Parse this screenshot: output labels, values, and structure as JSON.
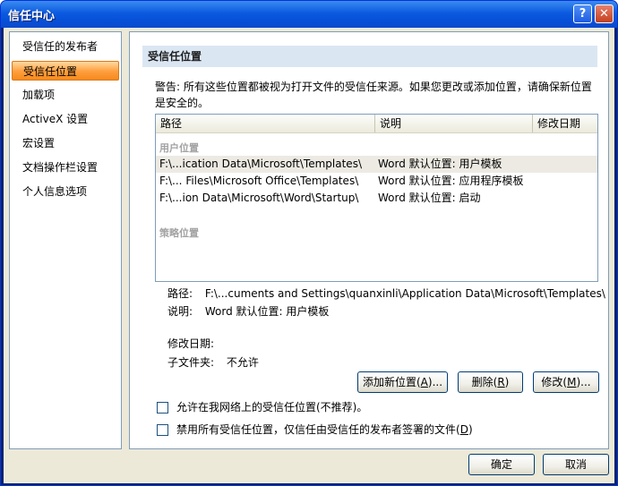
{
  "window": {
    "title": "信任中心",
    "help_label": "?",
    "close_label": "✕"
  },
  "sidebar": {
    "items": [
      {
        "label": "受信任的发布者"
      },
      {
        "label": "受信任位置",
        "selected": true
      },
      {
        "label": "加载项"
      },
      {
        "label": "ActiveX 设置"
      },
      {
        "label": "宏设置"
      },
      {
        "label": "文档操作栏设置"
      },
      {
        "label": "个人信息选项"
      }
    ]
  },
  "main": {
    "section_title": "受信任位置",
    "warning": "警告: 所有这些位置都被视为打开文件的受信任来源。如果您更改或添加位置，请确保新位置是安全的。",
    "columns": {
      "path": "路径",
      "description": "说明",
      "modified": "修改日期"
    },
    "groups": {
      "user": "用户位置",
      "policy": "策略位置"
    },
    "rows": [
      {
        "path": "F:\\...ication Data\\Microsoft\\Templates\\",
        "description": "Word 默认位置: 用户模板"
      },
      {
        "path": "F:\\... Files\\Microsoft Office\\Templates\\",
        "description": "Word 默认位置: 应用程序模板"
      },
      {
        "path": "F:\\...ion Data\\Microsoft\\Word\\Startup\\",
        "description": "Word 默认位置: 启动"
      }
    ],
    "details": {
      "path_label": "路径:",
      "path_value": "F:\\...cuments and Settings\\quanxinli\\Application Data\\Microsoft\\Templates\\",
      "desc_label": "说明:",
      "desc_value": "Word 默认位置: 用户模板",
      "modified_label": "修改日期:",
      "subfolders_label": "子文件夹:",
      "subfolders_value": "不允许"
    },
    "buttons": {
      "add_prefix": "添加新位置(",
      "add_key": "A",
      "add_suffix": ")...",
      "remove_prefix": "删除(",
      "remove_key": "R",
      "remove_suffix": ")",
      "modify_prefix": "修改(",
      "modify_key": "M",
      "modify_suffix": ")..."
    },
    "checkboxes": [
      {
        "label": "允许在我网络上的受信任位置(不推荐)。",
        "checked": false
      },
      {
        "label_prefix": "禁用所有受信任位置，仅信任由受信任的发布者签署的文件(",
        "label_key": "D",
        "label_suffix": ")",
        "checked": false
      }
    ]
  },
  "footer": {
    "ok_label": "确定",
    "cancel_label": "取消"
  }
}
